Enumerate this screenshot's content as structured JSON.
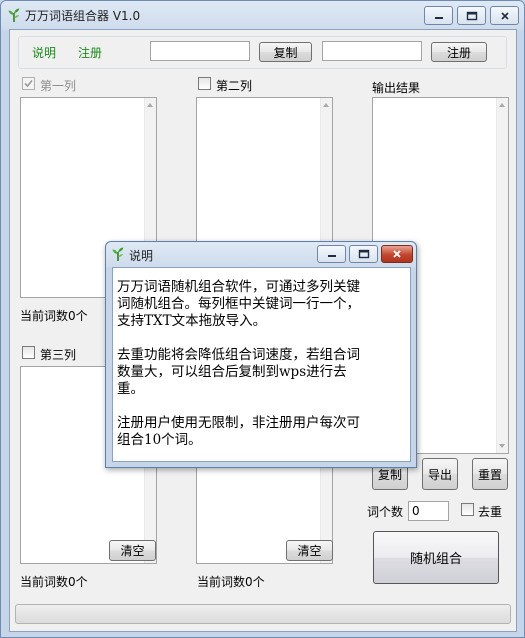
{
  "app": {
    "title": "万万词语组合器 V1.0"
  },
  "toolbar": {
    "help_link": "说明",
    "register_link": "注册",
    "copy_button": "复制",
    "register_button": "注册",
    "field1_value": "",
    "field2_value": ""
  },
  "columns": {
    "col1": {
      "label": "第一列",
      "checked": true,
      "disabled": true,
      "count_label": "当前词数0个"
    },
    "col2": {
      "label": "第二列",
      "checked": false
    },
    "col3": {
      "label": "第三列",
      "checked": false,
      "count_label": "当前词数0个",
      "clear_button": "清空"
    },
    "col4": {
      "count_label": "当前词数0个",
      "clear_button": "清空"
    }
  },
  "output": {
    "label": "输出结果",
    "copy_button": "复制",
    "export_button": "导出",
    "reset_button": "重置",
    "word_count_label": "词个数",
    "word_count_value": "0",
    "dedupe_label": "去重",
    "dedupe_checked": false,
    "combine_button": "随机组合"
  },
  "progress": {
    "value": 0
  },
  "dialog": {
    "title": "说明",
    "lines": [
      "万万词语随机组合软件，可通过多列关键",
      "词随机组合。每列框中关键词一行一个，",
      "支持TXT文本拖放导入。",
      "",
      "去重功能将会降低组合词速度，若组合词",
      "数量大，可以组合后复制到wps进行去",
      "重。",
      "",
      "注册用户使用无限制，非注册用户每次可",
      "组合10个词。"
    ]
  },
  "colors": {
    "title_gradient_top": "#dfe9f5",
    "client_bg": "#f0f0f0",
    "link_green": "#1a8a1a",
    "close_red": "#c2452d",
    "app_icon_green": "#3a9a2a"
  },
  "icons": {
    "app_icon": "sprout-icon",
    "minimize": "minimize-icon",
    "maximize": "maximize-icon",
    "close": "close-icon"
  }
}
